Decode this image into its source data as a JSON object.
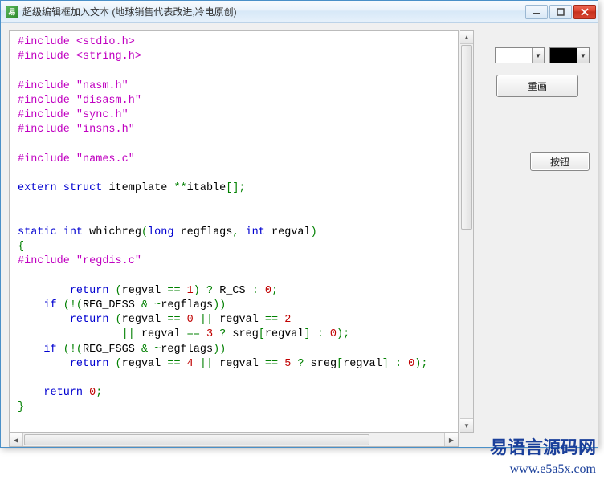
{
  "window": {
    "title": "超级编辑框加入文本 (地球销售代表改进,冷电原创)",
    "app_icon_glyph": "易"
  },
  "right_panel": {
    "combo1_value": "",
    "combo2_value": "",
    "redraw_button": "重画",
    "button_label": "按钮"
  },
  "watermark": {
    "line1": "易语言源码网",
    "line2": "www.e5a5x.com"
  },
  "code_lines": [
    [
      [
        "pre",
        "#include "
      ],
      [
        "preang",
        "<stdio.h>"
      ]
    ],
    [
      [
        "pre",
        "#include "
      ],
      [
        "preang",
        "<string.h>"
      ]
    ],
    [],
    [
      [
        "pre",
        "#include "
      ],
      [
        "prequot",
        "\"nasm.h\""
      ]
    ],
    [
      [
        "pre",
        "#include "
      ],
      [
        "prequot",
        "\"disasm.h\""
      ]
    ],
    [
      [
        "pre",
        "#include "
      ],
      [
        "prequot",
        "\"sync.h\""
      ]
    ],
    [
      [
        "pre",
        "#include "
      ],
      [
        "prequot",
        "\"insns.h\""
      ]
    ],
    [],
    [
      [
        "pre",
        "#include "
      ],
      [
        "prequot",
        "\"names.c\""
      ]
    ],
    [],
    [
      [
        "kw",
        "extern "
      ],
      [
        "kw",
        "struct "
      ],
      [
        "id",
        "itemplate "
      ],
      [
        "op",
        "**"
      ],
      [
        "id",
        "itable"
      ],
      [
        "op",
        "[];"
      ]
    ],
    [],
    [],
    [
      [
        "kw",
        "static "
      ],
      [
        "kw",
        "int "
      ],
      [
        "id",
        "whichreg"
      ],
      [
        "op",
        "("
      ],
      [
        "kw",
        "long "
      ],
      [
        "id",
        "regflags"
      ],
      [
        "op",
        ","
      ],
      [
        "kw",
        " int "
      ],
      [
        "id",
        "regval"
      ],
      [
        "op",
        ")"
      ]
    ],
    [
      [
        "op",
        "{"
      ]
    ],
    [
      [
        "pre",
        "#include "
      ],
      [
        "prequot",
        "\"regdis.c\""
      ]
    ],
    [],
    [
      [
        "id",
        "        "
      ],
      [
        "kw",
        "return "
      ],
      [
        "op",
        "("
      ],
      [
        "id",
        "regval "
      ],
      [
        "op",
        "== "
      ],
      [
        "num",
        "1"
      ],
      [
        "op",
        ") ? "
      ],
      [
        "id",
        "R_CS "
      ],
      [
        "op",
        ": "
      ],
      [
        "num",
        "0"
      ],
      [
        "op",
        ";"
      ]
    ],
    [
      [
        "id",
        "    "
      ],
      [
        "kw",
        "if "
      ],
      [
        "op",
        "(!("
      ],
      [
        "id",
        "REG_DESS "
      ],
      [
        "op",
        "& ~"
      ],
      [
        "id",
        "regflags"
      ],
      [
        "op",
        "))"
      ]
    ],
    [
      [
        "id",
        "        "
      ],
      [
        "kw",
        "return "
      ],
      [
        "op",
        "("
      ],
      [
        "id",
        "regval "
      ],
      [
        "op",
        "== "
      ],
      [
        "num",
        "0"
      ],
      [
        "op",
        " || "
      ],
      [
        "id",
        "regval "
      ],
      [
        "op",
        "== "
      ],
      [
        "num",
        "2"
      ]
    ],
    [
      [
        "id",
        "                "
      ],
      [
        "op",
        "|| "
      ],
      [
        "id",
        "regval "
      ],
      [
        "op",
        "== "
      ],
      [
        "num",
        "3"
      ],
      [
        "op",
        " ? "
      ],
      [
        "id",
        "sreg"
      ],
      [
        "op",
        "["
      ],
      [
        "id",
        "regval"
      ],
      [
        "op",
        "] : "
      ],
      [
        "num",
        "0"
      ],
      [
        "op",
        ");"
      ]
    ],
    [
      [
        "id",
        "    "
      ],
      [
        "kw",
        "if "
      ],
      [
        "op",
        "(!("
      ],
      [
        "id",
        "REG_FSGS "
      ],
      [
        "op",
        "& ~"
      ],
      [
        "id",
        "regflags"
      ],
      [
        "op",
        "))"
      ]
    ],
    [
      [
        "id",
        "        "
      ],
      [
        "kw",
        "return "
      ],
      [
        "op",
        "("
      ],
      [
        "id",
        "regval "
      ],
      [
        "op",
        "== "
      ],
      [
        "num",
        "4"
      ],
      [
        "op",
        " || "
      ],
      [
        "id",
        "regval "
      ],
      [
        "op",
        "== "
      ],
      [
        "num",
        "5"
      ],
      [
        "op",
        " ? "
      ],
      [
        "id",
        "sreg"
      ],
      [
        "op",
        "["
      ],
      [
        "id",
        "regval"
      ],
      [
        "op",
        "] : "
      ],
      [
        "num",
        "0"
      ],
      [
        "op",
        ");"
      ]
    ],
    [],
    [
      [
        "id",
        "    "
      ],
      [
        "kw",
        "return "
      ],
      [
        "num",
        "0"
      ],
      [
        "op",
        ";"
      ]
    ],
    [
      [
        "op",
        "}"
      ]
    ]
  ]
}
